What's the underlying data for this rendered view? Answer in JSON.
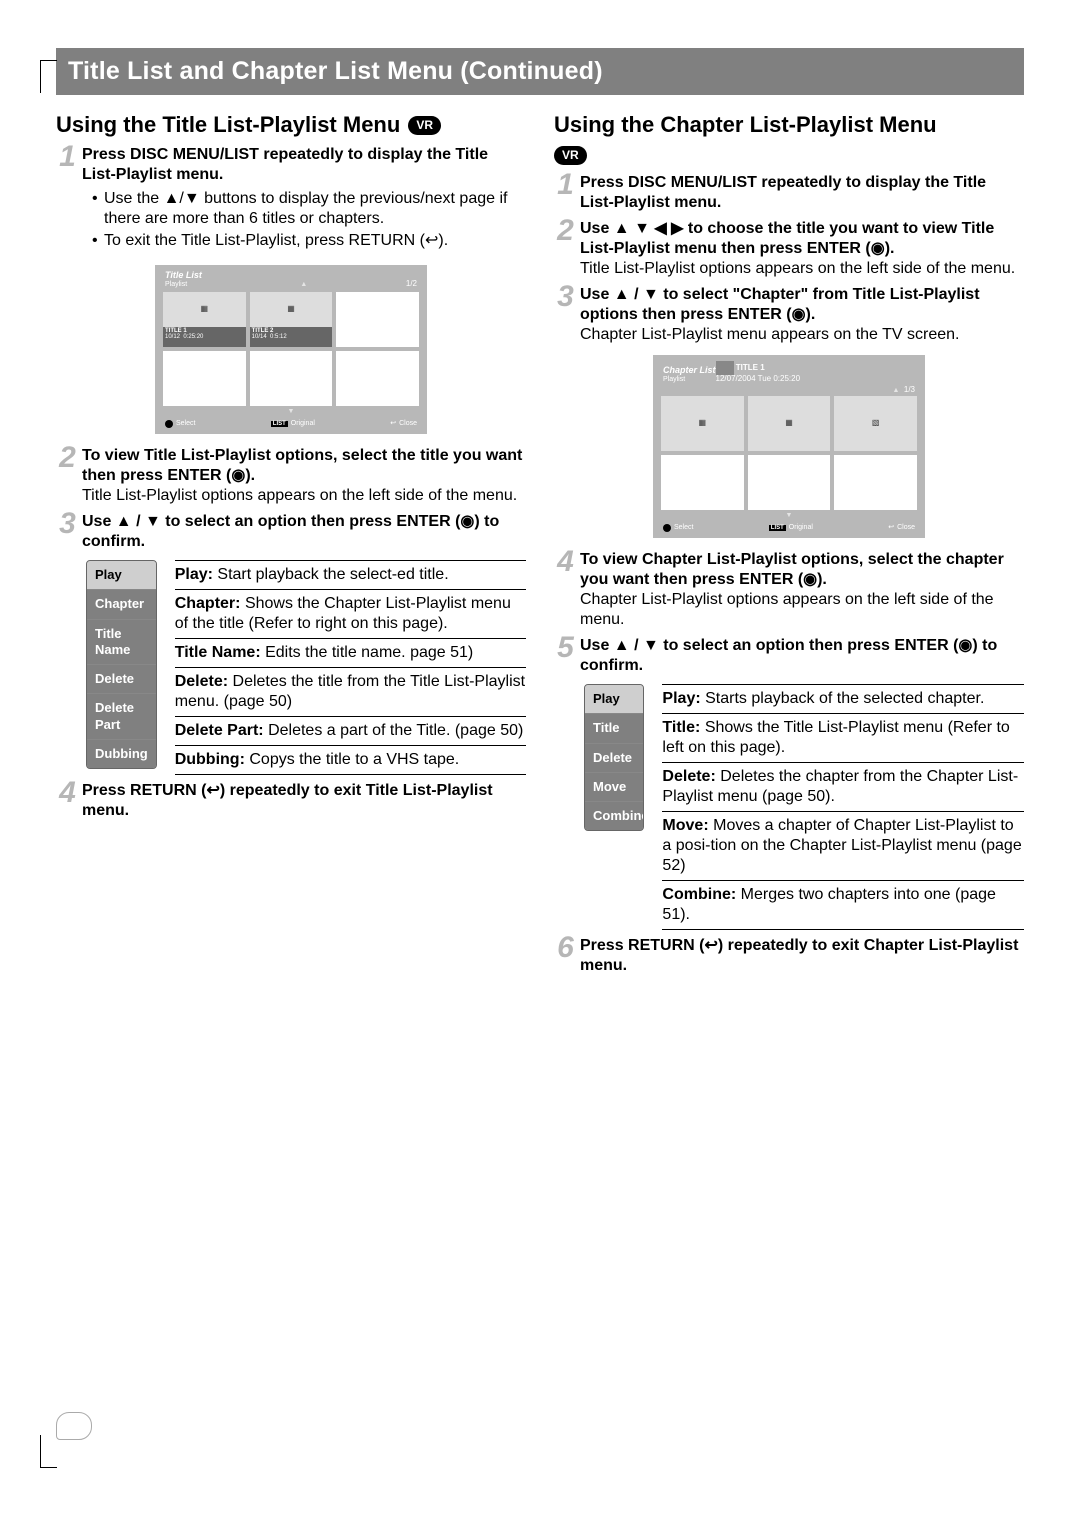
{
  "banner": "Title List and Chapter List Menu (Continued)",
  "left": {
    "heading": "Using the Title List-Playlist Menu",
    "vr": "VR",
    "step1_lead": "Press DISC MENU/LIST repeatedly to display the Title List-Playlist menu.",
    "step1_b1": "Use the ▲/▼ buttons to display the previous/next page if there are more than 6 titles or chapters.",
    "step1_b2": "To exit the Title List-Playlist, press RETURN (↩).",
    "shot1": {
      "title": "Title List",
      "sub": "Playlist",
      "page": "1/2",
      "t1_name": "TITLE 1",
      "t1_date": "10/12",
      "t1_dur": "0:25:20",
      "t2_name": "TITLE 2",
      "t2_date": "10/14",
      "t2_dur": "0:5:12",
      "f_select": "Select",
      "f_orig": "Original",
      "f_close": "Close"
    },
    "step2_lead": "To view Title List-Playlist options, select the title you want then press ENTER (◉).",
    "step2_body": "Title List-Playlist options appears on the left side of the menu.",
    "step3_lead": "Use ▲ / ▼ to select an option then press ENTER (◉) to confirm.",
    "menu": [
      "Play",
      "Chapter",
      "Title Name",
      "Delete",
      "Delete Part",
      "Dubbing"
    ],
    "defs": [
      {
        "t": "Play:",
        "b": "Start playback the select-ed title."
      },
      {
        "t": "Chapter:",
        "b": "Shows the Chapter List-Playlist menu of the title (Refer to right on this page)."
      },
      {
        "t": "Title Name:",
        "b": "Edits the title name. page 51)"
      },
      {
        "t": "Delete:",
        "b": "Deletes the title from the Title List-Playlist  menu. (page 50)"
      },
      {
        "t": "Delete Part:",
        "b": "Deletes a part of the Title. (page 50)"
      },
      {
        "t": "Dubbing:",
        "b": "Copys the title to a VHS tape."
      }
    ],
    "step4_lead": "Press RETURN (↩) repeatedly to exit Title List-Playlist menu."
  },
  "right": {
    "heading": "Using the Chapter List-Playlist Menu",
    "vr": "VR",
    "step1_lead": "Press DISC MENU/LIST repeatedly to display the Title List-Playlist menu.",
    "step2_lead": "Use ▲ ▼ ◀ ▶ to choose the title you want to view Title List-Playlist menu then press ENTER (◉).",
    "step2_body": "Title List-Playlist options appears on the left side of the menu.",
    "step3_lead": "Use ▲ / ▼ to select \"Chapter\" from Title List-Playlist options then press ENTER (◉).",
    "step3_body": "Chapter List-Playlist menu appears on the TV screen.",
    "shot2": {
      "title": "Chapter List",
      "sub": "Playlist",
      "titbar": "TITLE 1",
      "titbar2": "12/07/2004  Tue 0:25:20",
      "page": "1/3",
      "f_select": "Select",
      "f_orig": "Original",
      "f_close": "Close"
    },
    "step4_lead": "To view Chapter List-Playlist options, select the chapter you want then press ENTER (◉).",
    "step4_body": "Chapter List-Playlist options appears on the left side of the menu.",
    "step5_lead": "Use ▲ / ▼ to select an option then press ENTER (◉) to confirm.",
    "menu": [
      "Play",
      "Title",
      "Delete",
      "Move",
      "Combine"
    ],
    "defs": [
      {
        "t": "Play:",
        "b": "Starts playback of the selected chapter."
      },
      {
        "t": "Title:",
        "b": "Shows the Title List-Playlist menu (Refer to left on this page)."
      },
      {
        "t": "Delete:",
        "b": "Deletes the chapter from the Chapter List-Playlist menu (page 50)."
      },
      {
        "t": "Move:",
        "b": "Moves a chapter of Chapter List-Playlist to a posi-tion on the Chapter List-Playlist menu (page 52)"
      },
      {
        "t": "Combine:",
        "b": "Merges two chapters into one (page 51)."
      }
    ],
    "step6_lead": "Press RETURN (↩) repeatedly to exit Chapter List-Playlist menu."
  }
}
